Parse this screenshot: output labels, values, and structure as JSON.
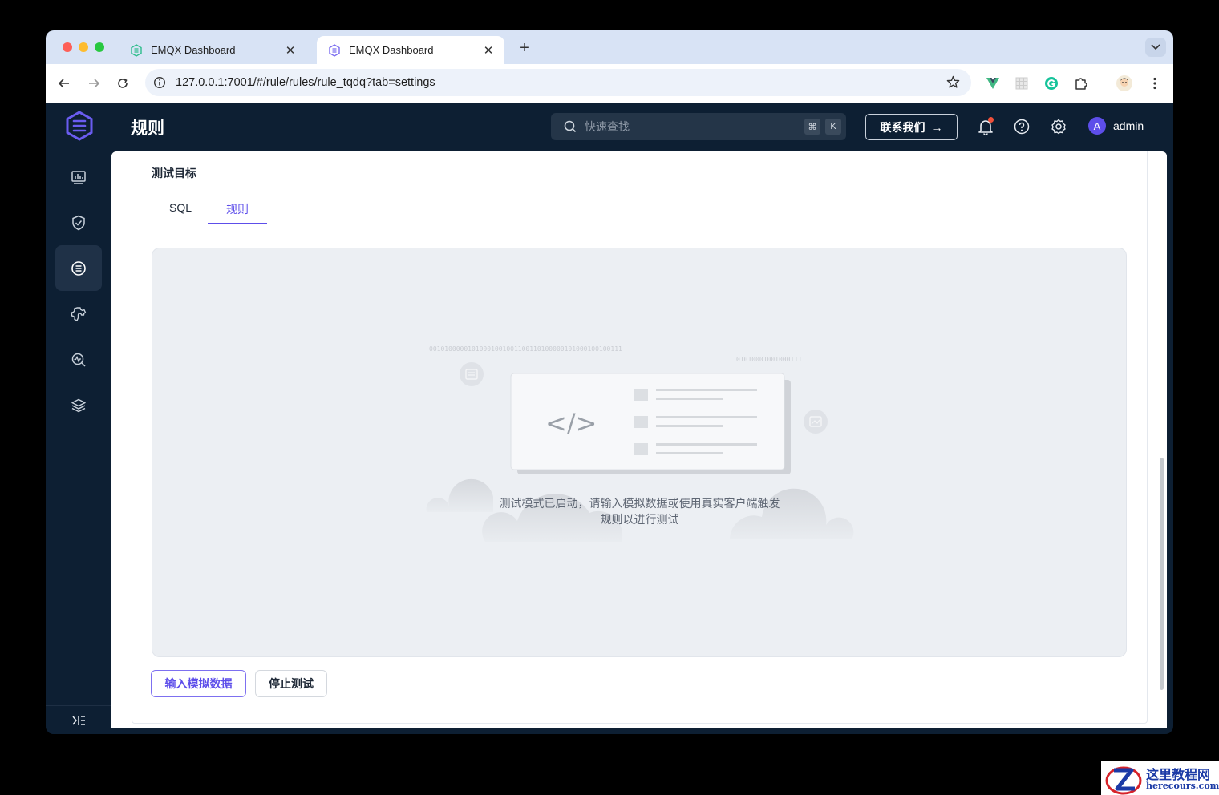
{
  "browser": {
    "tabs": [
      {
        "title": "EMQX Dashboard",
        "active": false
      },
      {
        "title": "EMQX Dashboard",
        "active": true
      }
    ],
    "url": "127.0.0.1:7001/#/rule/rules/rule_tqdq?tab=settings"
  },
  "header": {
    "title": "规则",
    "search_placeholder": "快速查找",
    "shortcut_keys": [
      "⌘",
      "K"
    ],
    "contact_label": "联系我们",
    "user_initial": "A",
    "username": "admin"
  },
  "sidebar": {
    "items": [
      {
        "icon": "dashboard-icon",
        "active": false
      },
      {
        "icon": "shield-icon",
        "active": false
      },
      {
        "icon": "integration-icon",
        "active": true
      },
      {
        "icon": "settings-puzzle-icon",
        "active": false
      },
      {
        "icon": "diagnose-icon",
        "active": false
      },
      {
        "icon": "layers-icon",
        "active": false
      }
    ],
    "collapse_icon": "collapse-icon"
  },
  "main": {
    "section_title": "测试目标",
    "tabs": [
      {
        "label": "SQL",
        "active": false
      },
      {
        "label": "规则",
        "active": true
      }
    ],
    "illustration": {
      "binary_text_1": "00101000001010001001001100110100000101000100100111",
      "binary_text_2": "01010001001000111",
      "code_symbol": "</>"
    },
    "empty_message": "测试模式已启动，请输入模拟数据或使用真实客户端触发规则以进行测试",
    "buttons": {
      "input_mock": "输入模拟数据",
      "stop_test": "停止测试"
    }
  },
  "watermark": {
    "cn": "这里教程网",
    "en": "herecours.com"
  },
  "colors": {
    "accent": "#5d4eea",
    "header_bg": "#0d1f33",
    "notification_dot": "#f0503a"
  }
}
